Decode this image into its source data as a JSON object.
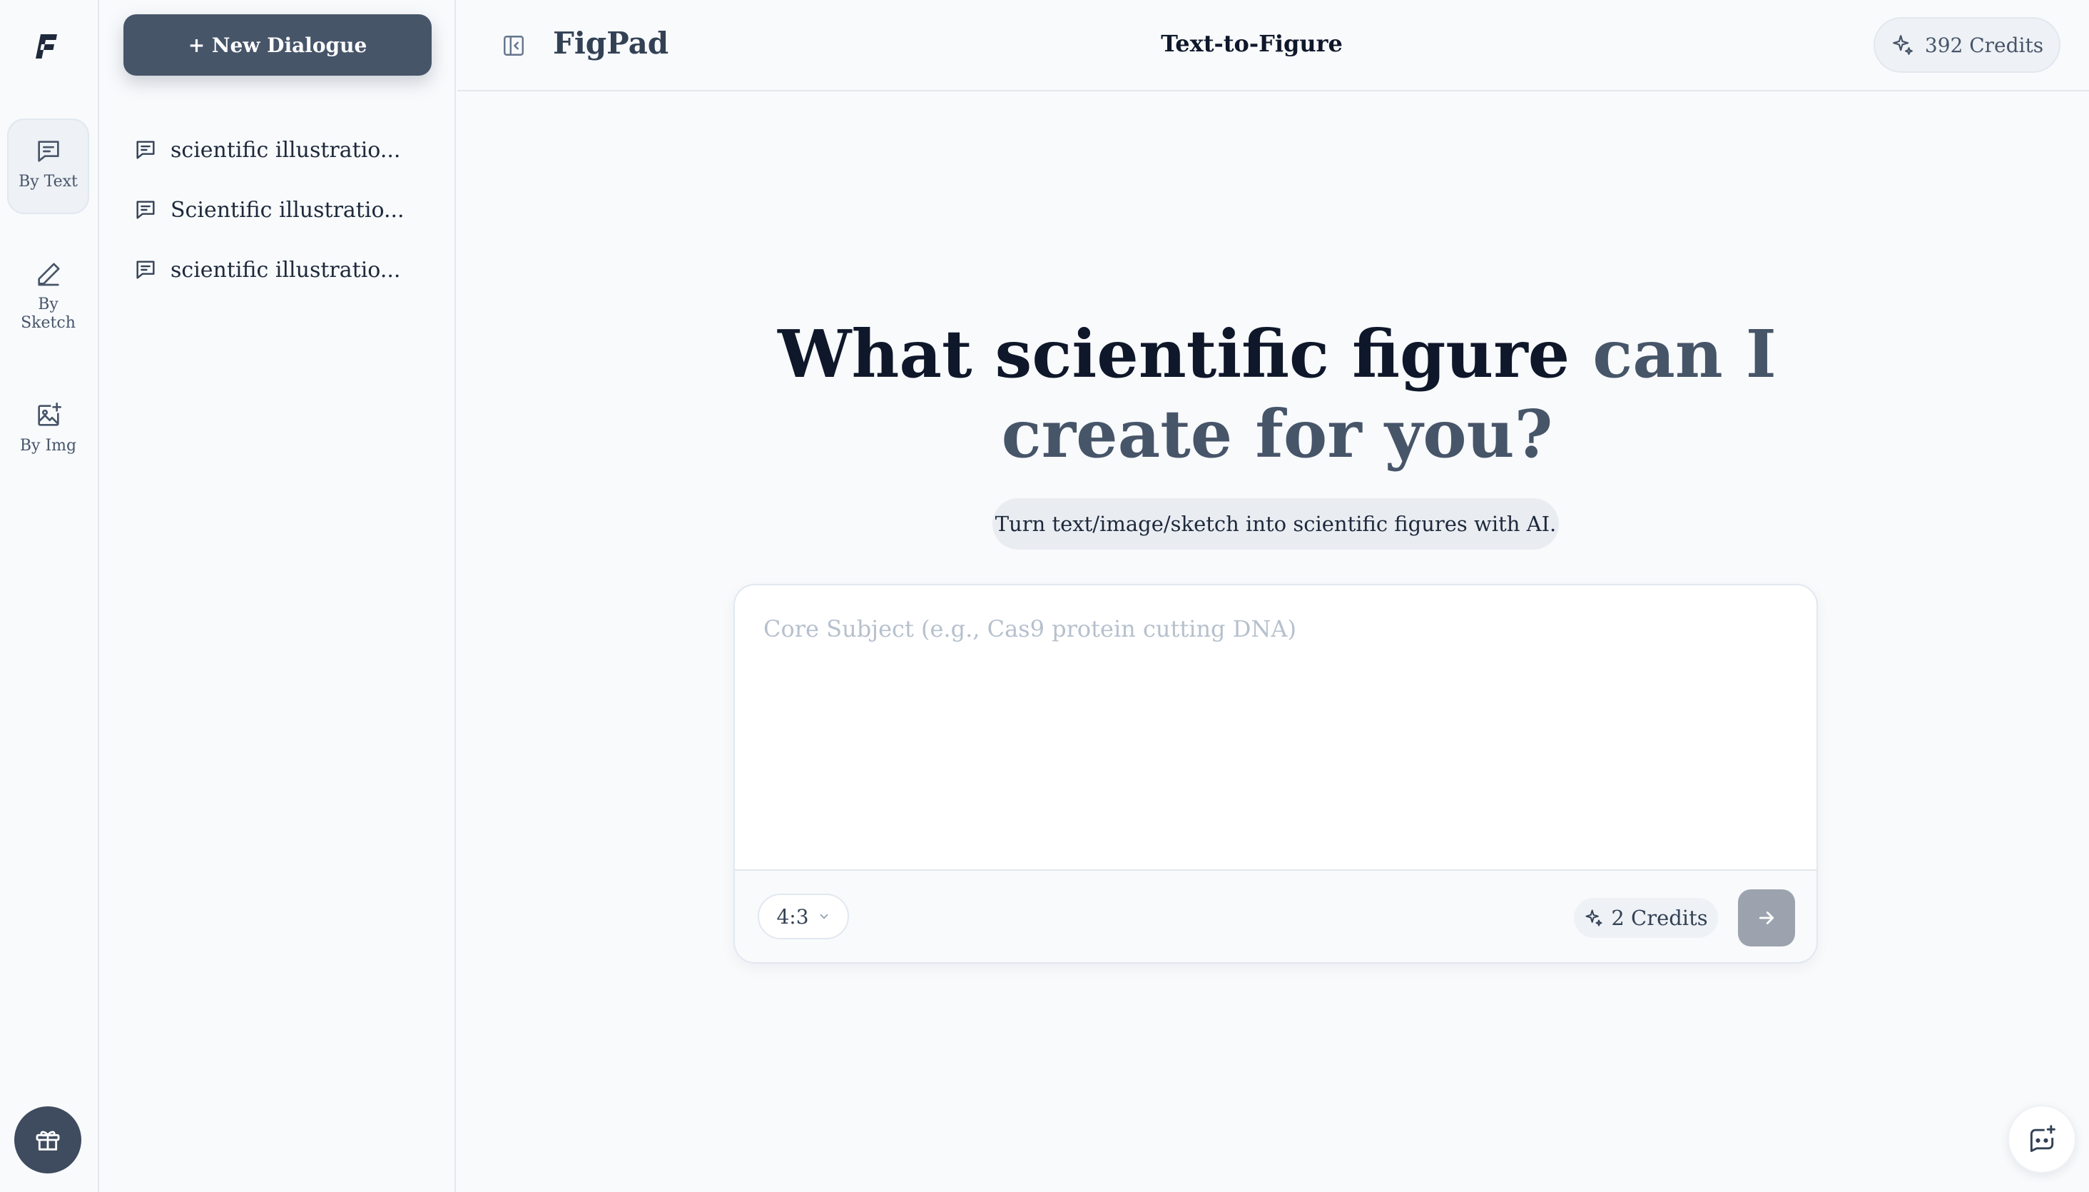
{
  "app": {
    "brand": "FigPad",
    "page_title": "Text-to-Figure",
    "credits_label": "392 Credits",
    "accent_color": "#475569"
  },
  "rail": {
    "items": [
      {
        "label": "By Text",
        "icon": "message-square-icon",
        "active": true
      },
      {
        "label": "By\nSketch",
        "icon": "pencil-icon",
        "active": false
      },
      {
        "label": "By Img",
        "icon": "image-plus-icon",
        "active": false
      }
    ],
    "bottom_icon": "gift-icon"
  },
  "sidebar": {
    "new_button_label": "+ New Dialogue",
    "history": [
      {
        "title": "scientific illustratio..."
      },
      {
        "title": "Scientific illustratio..."
      },
      {
        "title": "scientific illustratio..."
      }
    ]
  },
  "main": {
    "headline_primary": "What scientific figure",
    "headline_accent": "can I create for you?",
    "subtitle": "Turn text/image/sketch into scientific figures with AI.",
    "composer": {
      "placeholder": "Core Subject (e.g., Cas9 protein cutting DNA)",
      "value": "",
      "aspect_ratio": "4:3",
      "cost_label": "2 Credits"
    }
  }
}
